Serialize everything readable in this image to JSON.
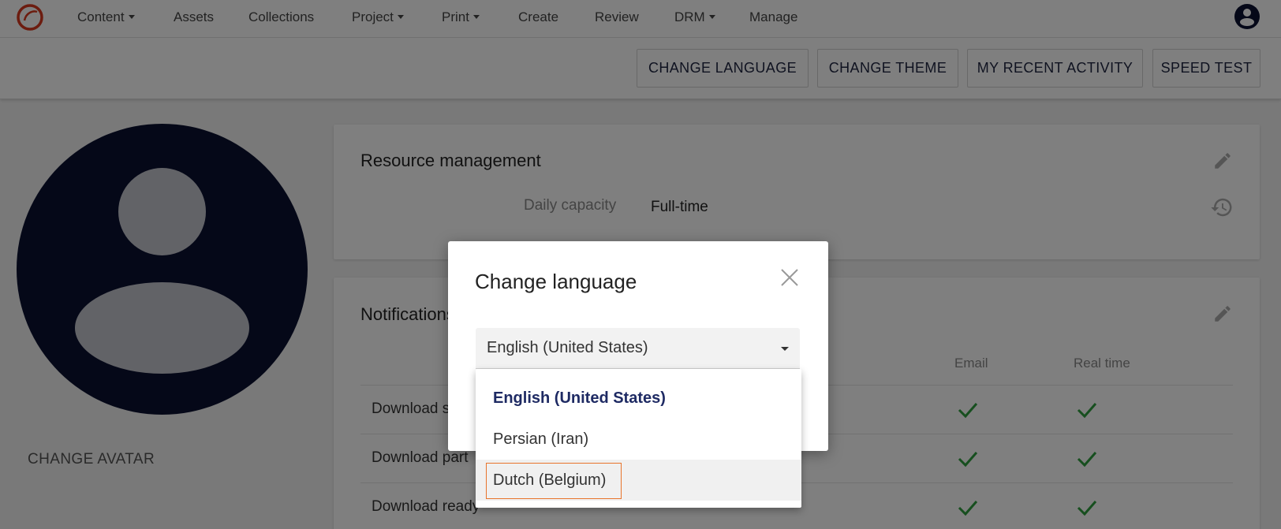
{
  "nav": {
    "items": [
      {
        "label": "Content",
        "dropdown": true
      },
      {
        "label": "Assets",
        "dropdown": false
      },
      {
        "label": "Collections",
        "dropdown": false
      },
      {
        "label": "Project",
        "dropdown": true
      },
      {
        "label": "Print",
        "dropdown": true
      },
      {
        "label": "Create",
        "dropdown": false
      },
      {
        "label": "Review",
        "dropdown": false
      },
      {
        "label": "DRM",
        "dropdown": true
      },
      {
        "label": "Manage",
        "dropdown": false
      }
    ],
    "logo_icon": "app-logo-icon",
    "user_icon": "user-account-icon",
    "brand_color": "#d9381e"
  },
  "actions": {
    "change_language": "CHANGE LANGUAGE",
    "change_theme": "CHANGE THEME",
    "recent_activity": "MY RECENT ACTIVITY",
    "speed_test": "SPEED TEST"
  },
  "profile": {
    "change_avatar": "CHANGE AVATAR",
    "avatar_color": "#0b1030"
  },
  "resource": {
    "title": "Resource management",
    "daily_capacity_label": "Daily capacity",
    "daily_capacity_value": "Full-time"
  },
  "notifications": {
    "title": "Notifications",
    "col_email": "Email",
    "col_realtime": "Real time",
    "rows": [
      {
        "label": "Download s",
        "email": true,
        "realtime": true
      },
      {
        "label": "Download part",
        "email": true,
        "realtime": true
      },
      {
        "label": "Download ready",
        "email": true,
        "realtime": true
      }
    ],
    "check_color": "#2e9e3e"
  },
  "modal": {
    "title": "Change language",
    "selected_value": "English (United States)",
    "options": [
      "English (United States)",
      "Persian (Iran)",
      "Dutch (Belgium)"
    ],
    "selected_index": 0,
    "highlighted_index": 2,
    "focus_color": "#e8742c"
  }
}
